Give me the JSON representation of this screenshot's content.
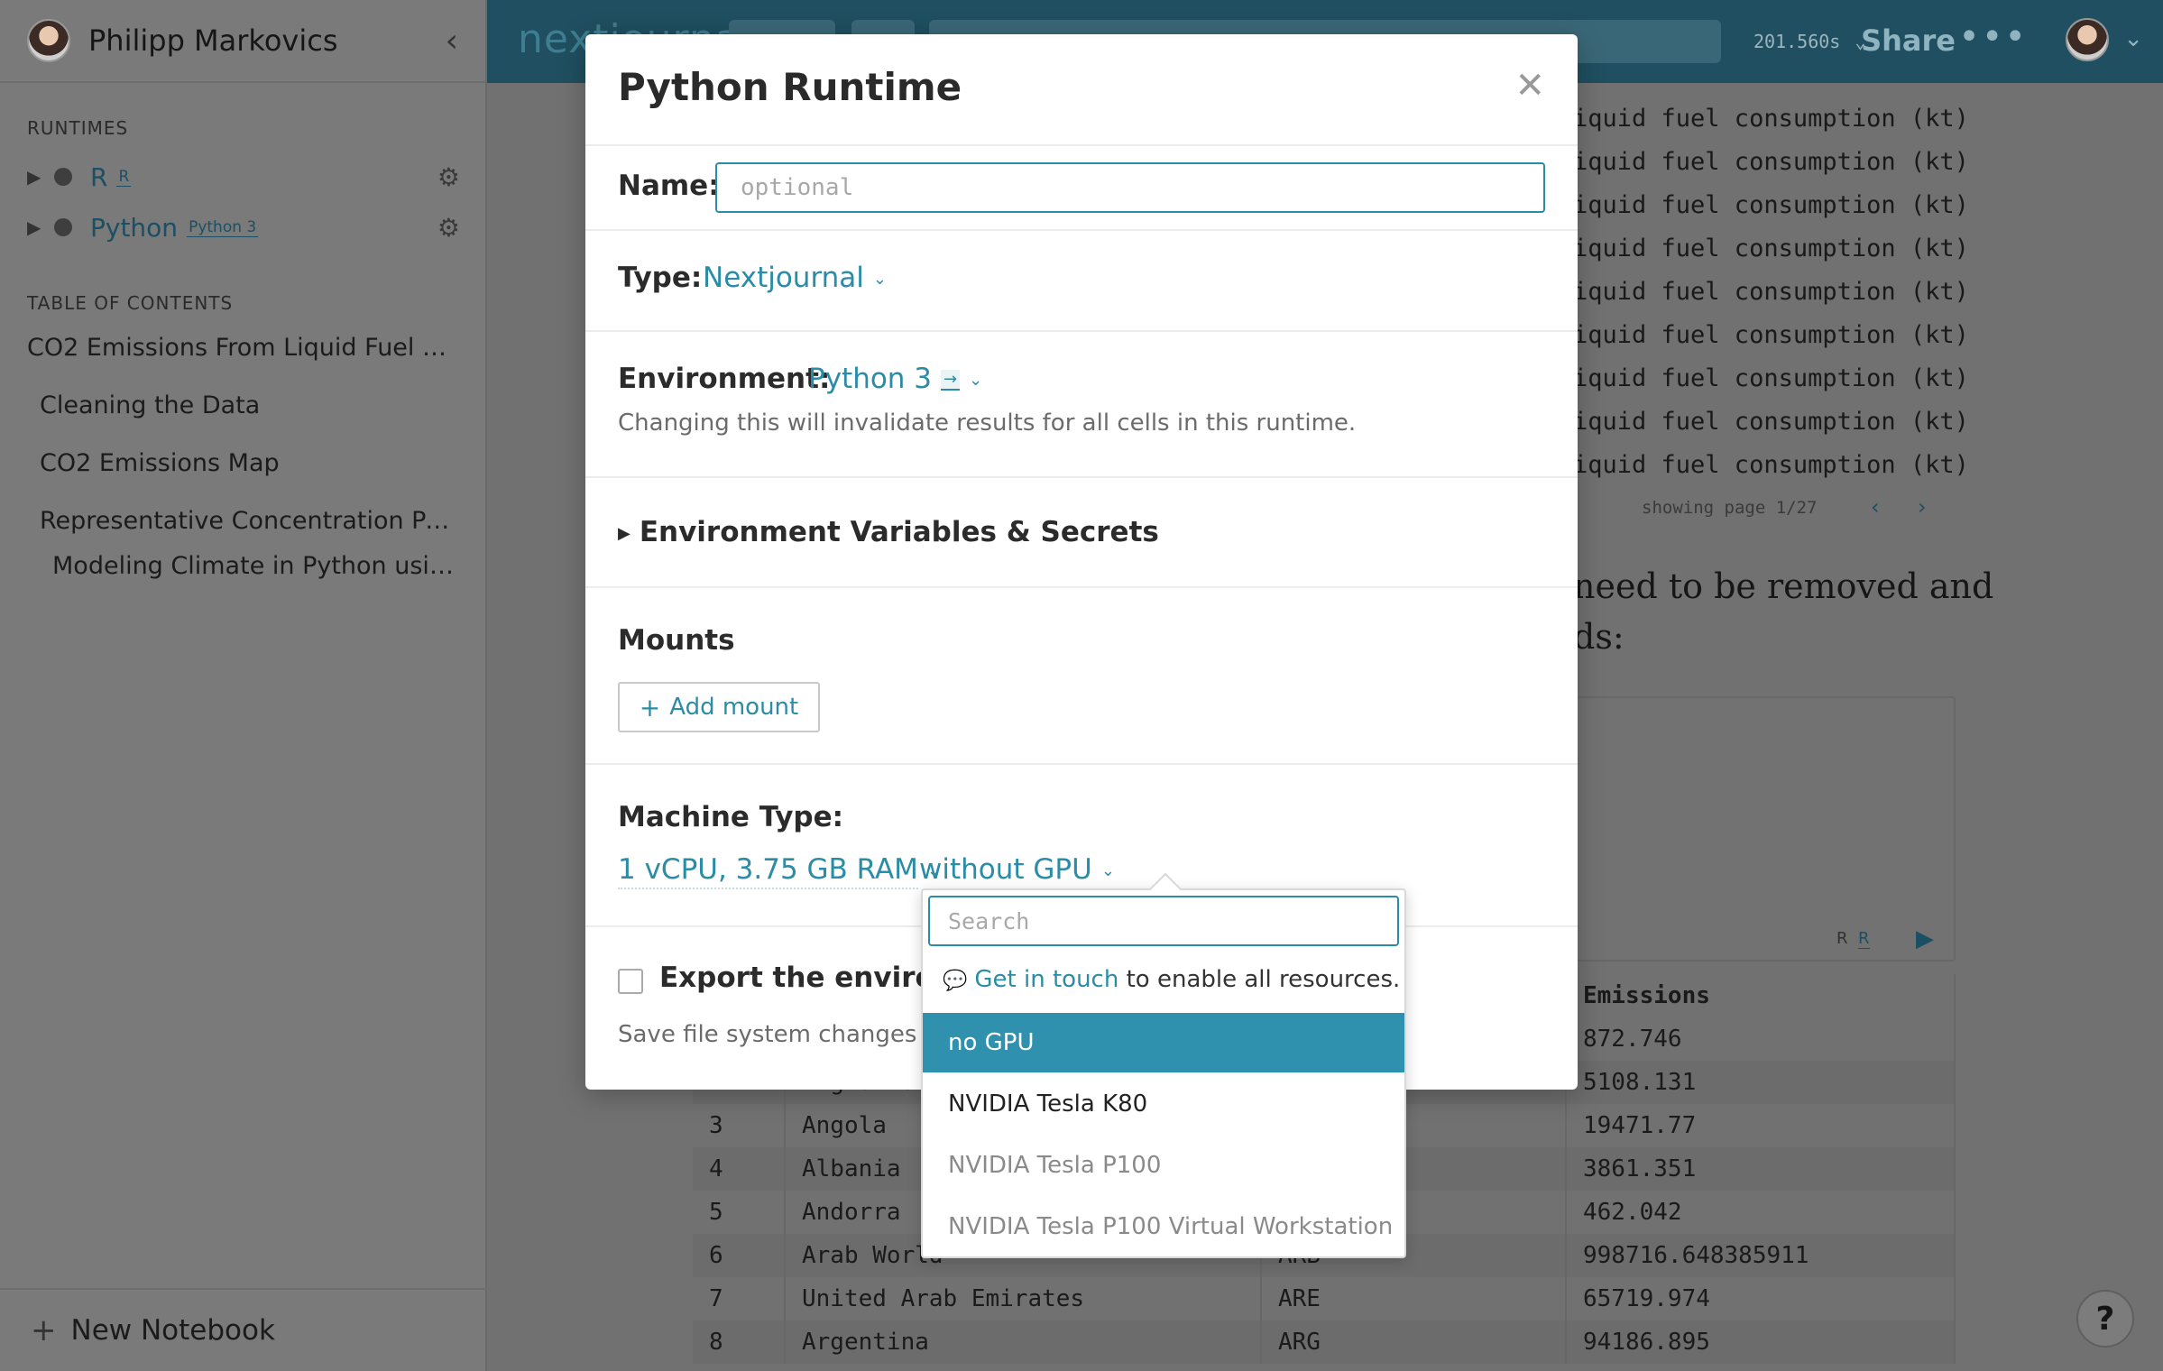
{
  "sidebar": {
    "username": "Philipp Markovics",
    "runtimes_title": "RUNTIMES",
    "runtimes": [
      {
        "name": "R",
        "badge": "R"
      },
      {
        "name": "Python",
        "badge": "Python 3"
      }
    ],
    "toc_title": "TABLE OF CONTENTS",
    "toc": [
      "CO2 Emissions From Liquid Fuel Con...",
      "Cleaning the Data",
      "CO2 Emissions Map",
      "Representative Concentration Path...",
      "Modeling Climate in Python using..."
    ],
    "new_notebook": "New Notebook"
  },
  "topbar": {
    "logo": "nextjournal",
    "timer": "201.560s",
    "share": "Share"
  },
  "background": {
    "fuel_rows": [
      "iquid fuel consumption (kt)",
      "iquid fuel consumption (kt)",
      "iquid fuel consumption (kt)",
      "iquid fuel consumption (kt)",
      "iquid fuel consumption (kt)",
      "iquid fuel consumption (kt)",
      "iquid fuel consumption (kt)",
      "iquid fuel consumption (kt)",
      "iquid fuel consumption (kt)"
    ],
    "paging": "showing page 1/27",
    "prose_line1": "need to be removed and",
    "prose_line2": "ds:",
    "cell_lang": "R",
    "cell_badge": "R",
    "table_header_emissions": "Emissions",
    "table_rows": [
      {
        "n": "",
        "country": "",
        "code": "",
        "emissions": "872.746"
      },
      {
        "n": "2",
        "country": "Afghanis",
        "code": "",
        "emissions": "5108.131"
      },
      {
        "n": "3",
        "country": "Angola",
        "code": "",
        "emissions": "19471.77"
      },
      {
        "n": "4",
        "country": "Albania",
        "code": "",
        "emissions": "3861.351"
      },
      {
        "n": "5",
        "country": "Andorra",
        "code": "",
        "emissions": "462.042"
      },
      {
        "n": "6",
        "country": "Arab World",
        "code": "ARB",
        "emissions": "998716.648385911"
      },
      {
        "n": "7",
        "country": "United Arab Emirates",
        "code": "ARE",
        "emissions": "65719.974"
      },
      {
        "n": "8",
        "country": "Argentina",
        "code": "ARG",
        "emissions": "94186.895"
      }
    ],
    "help": "?"
  },
  "modal": {
    "title": "Python Runtime",
    "name_label": "Name:",
    "name_value": "",
    "name_placeholder": "optional",
    "type_label": "Type:",
    "type_value": "Nextjournal",
    "env_label": "Environment:",
    "env_value": "Python 3",
    "env_note": "Changing this will invalidate results for all cells in this runtime.",
    "env_vars_label": "Environment Variables & Secrets",
    "mounts_label": "Mounts",
    "add_mount": "Add mount",
    "machine_label": "Machine Type:",
    "machine_value": "1 vCPU, 3.75 GB RAM",
    "gpu_value": "without GPU",
    "export_label": "Export the environm",
    "save_note": "Save file system changes a"
  },
  "dropdown": {
    "search_value": "",
    "search_placeholder": "Search",
    "hint_link": "Get in touch",
    "hint_text": " to enable all resources.",
    "options": [
      {
        "label": "no GPU",
        "state": "selected"
      },
      {
        "label": "NVIDIA Tesla K80",
        "state": "enabled"
      },
      {
        "label": "NVIDIA Tesla P100",
        "state": "disabled"
      },
      {
        "label": "NVIDIA Tesla P100 Virtual Workstation",
        "state": "disabled"
      }
    ]
  },
  "colors": {
    "accent": "#2a8ca6",
    "selected": "#2f91ad",
    "topbar": "#1f4f60"
  }
}
